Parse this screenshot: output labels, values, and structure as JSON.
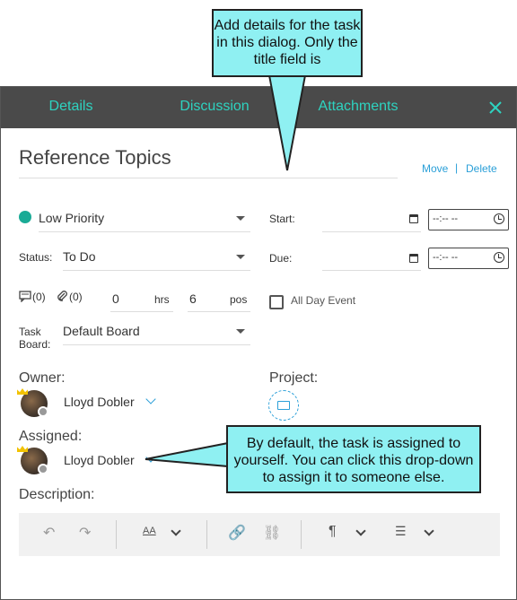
{
  "tabs": [
    "Details",
    "Discussion",
    "Attachments"
  ],
  "task": {
    "title": "Reference Topics",
    "move_label": "Move",
    "separator": "|",
    "delete_label": "Delete"
  },
  "priority": {
    "value": "Low Priority",
    "color": "#1aab96"
  },
  "start": {
    "label": "Start:",
    "time_placeholder": "--:-- --"
  },
  "status": {
    "label": "Status:",
    "value": "To Do"
  },
  "due": {
    "label": "Due:",
    "time_placeholder": "--:-- --"
  },
  "counts": {
    "comments": "(0)",
    "attachments": "(0)"
  },
  "estimate": {
    "hours": "0",
    "hours_unit": "hrs",
    "points": "6",
    "points_unit": "pos"
  },
  "all_day": {
    "label": "All Day Event",
    "checked": false
  },
  "task_board": {
    "label_line1": "Task",
    "label_line2": "Board:",
    "value": "Default Board"
  },
  "owner": {
    "label": "Owner:",
    "name": "Lloyd Dobler"
  },
  "project": {
    "label": "Project:"
  },
  "assigned": {
    "label": "Assigned:",
    "name": "Lloyd Dobler"
  },
  "description": {
    "label": "Description:"
  },
  "callouts": {
    "top": "Add details for the task in this dialog. Only the title field is",
    "bottom": "By default, the task is assigned to yourself. You can click this drop-down to assign it to someone else."
  },
  "colors": {
    "accent": "#2ed3c0",
    "link": "#2a9fd8",
    "header_bg": "#4a4a4a",
    "callout_bg": "#8ff0f2"
  }
}
